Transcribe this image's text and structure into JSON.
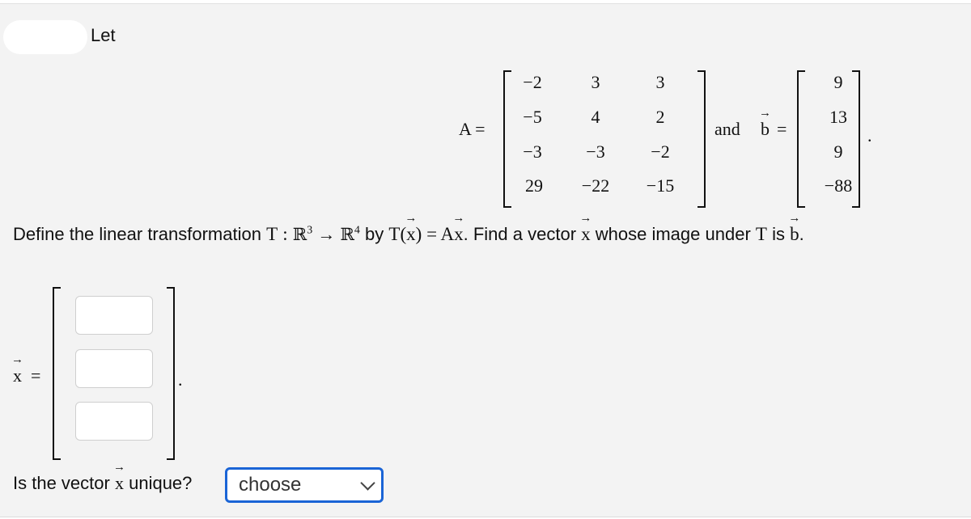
{
  "intro": "Let",
  "matrix_A": {
    "label": "A =",
    "rows": [
      [
        "−2",
        "3",
        "3"
      ],
      [
        "−5",
        "4",
        "2"
      ],
      [
        "−3",
        "−3",
        "−2"
      ],
      [
        "29",
        "−22",
        "−15"
      ]
    ]
  },
  "connector": "and",
  "vector_b": {
    "label": "b",
    "equals": "=",
    "values": [
      "9",
      "13",
      "9",
      "−88"
    ],
    "period": "."
  },
  "problem": {
    "p1": "Define the linear transformation",
    "T": "T",
    "colon": ":",
    "R": "ℝ",
    "dim_in": "3",
    "arrow": "→",
    "dim_out": "4",
    "p2": "by",
    "Tx_open": "T(",
    "x": "x",
    "Tx_close": ")",
    "eq": "= A",
    "p3": ". Find a vector",
    "p4": "whose image under",
    "p5": "is",
    "b": "b",
    "end": "."
  },
  "answer": {
    "x_label": "x",
    "equals": "=",
    "inputs": [
      "",
      "",
      ""
    ],
    "period": "."
  },
  "uniqueness": {
    "question_pre": "Is the vector",
    "x": "x",
    "question_post": "unique?",
    "select_value": "choose"
  }
}
